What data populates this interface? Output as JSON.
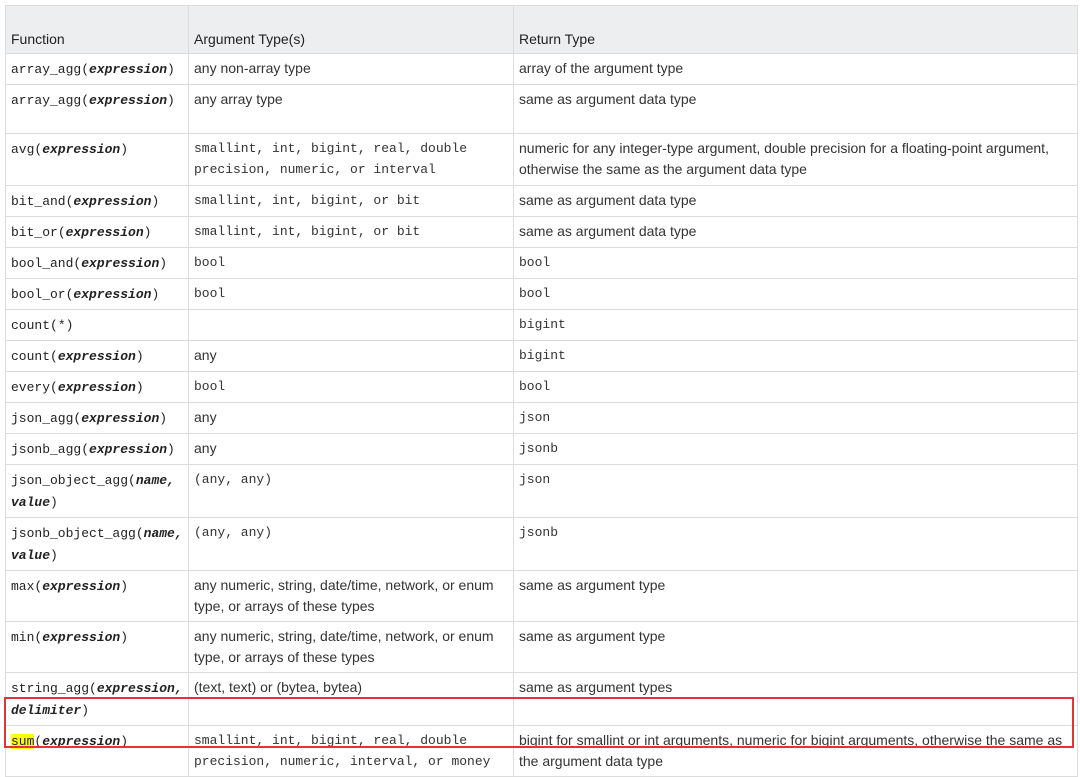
{
  "headers": [
    "Function",
    "Argument Type(s)",
    "Return Type"
  ],
  "rows": [
    {
      "fn": "array_agg",
      "args": "expression",
      "arg_types": "any non-array type",
      "ret": "array of the argument type"
    },
    {
      "fn": "array_agg",
      "args": "expression",
      "arg_types": "any array type",
      "ret": "same as argument data type"
    },
    {
      "fn": "avg",
      "args": "expression",
      "arg_types": "smallint, int, bigint, real, double precision, numeric, or interval",
      "ret": "numeric for any integer-type argument, double precision for a floating-point argument, otherwise the same as the argument data type"
    },
    {
      "fn": "bit_and",
      "args": "expression",
      "arg_types": "smallint, int, bigint, or bit",
      "ret": "same as argument data type"
    },
    {
      "fn": "bit_or",
      "args": "expression",
      "arg_types": "smallint, int, bigint, or bit",
      "ret": "same as argument data type"
    },
    {
      "fn": "bool_and",
      "args": "expression",
      "arg_types": "bool",
      "ret": "bool"
    },
    {
      "fn": "bool_or",
      "args": "expression",
      "arg_types": "bool",
      "ret": "bool"
    },
    {
      "fn": "count",
      "args": "*",
      "arg_types": "",
      "ret": "bigint"
    },
    {
      "fn": "count",
      "args": "expression",
      "arg_types": "any",
      "ret": "bigint"
    },
    {
      "fn": "every",
      "args": "expression",
      "arg_types": "bool",
      "ret": "bool"
    },
    {
      "fn": "json_agg",
      "args": "expression",
      "arg_types": "any",
      "ret": "json"
    },
    {
      "fn": "jsonb_agg",
      "args": "expression",
      "arg_types": "any",
      "ret": "jsonb"
    },
    {
      "fn": "json_object_agg",
      "args": "name, value",
      "arg_types": "(any, any)",
      "ret": "json"
    },
    {
      "fn": "jsonb_object_agg",
      "args": "name, value",
      "arg_types": "(any, any)",
      "ret": "jsonb"
    },
    {
      "fn": "max",
      "args": "expression",
      "arg_types": "any numeric, string, date/time, network, or enum type, or arrays of these types",
      "ret": "same as argument type"
    },
    {
      "fn": "min",
      "args": "expression",
      "arg_types": "any numeric, string, date/time, network, or enum type, or arrays of these types",
      "ret": "same as argument type"
    },
    {
      "fn": "string_agg",
      "args": "expression, delimiter",
      "arg_types": "(text, text) or (bytea, bytea)",
      "ret": "same as argument types"
    },
    {
      "fn": "sum",
      "args": "expression",
      "arg_types": "smallint, int, bigint, real, double precision, numeric, interval, or money",
      "ret": "bigint for smallint or int arguments, numeric for bigint arguments, otherwise the same as the argument data type"
    }
  ],
  "highlight": {
    "search_term": "sum",
    "mark_color": "#ffff00",
    "box_color": "#e0333b"
  }
}
